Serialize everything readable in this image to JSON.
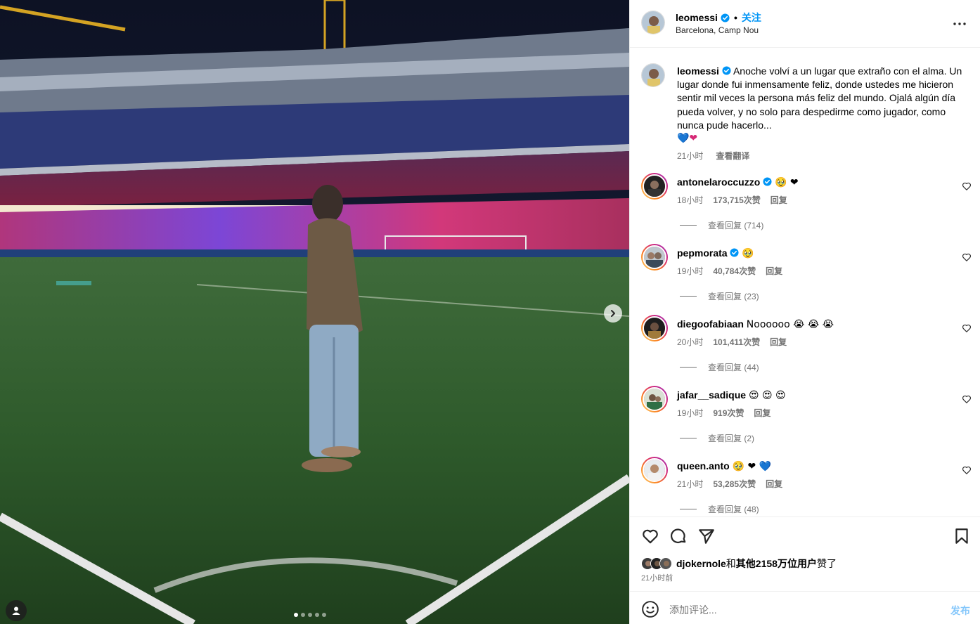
{
  "post": {
    "username": "leomessi",
    "follow_label": "关注",
    "separator": "•",
    "location": "Barcelona, Camp Nou",
    "more_icon": "more-horizontal-icon"
  },
  "caption": {
    "username": "leomessi",
    "text": "Anoche volví a un lugar que extraño con el alma. Un lugar donde fui inmensamente feliz, donde ustedes me hicieron sentir mil veces la persona más feliz del mundo. Ojalá algún día pueda volver, y no solo para despedirme como jugador, como nunca pude hacerlo...",
    "emojis": "💙❤",
    "time": "21小时",
    "translate_label": "查看翻译"
  },
  "comments": [
    {
      "username": "antonelaroccuzzo",
      "verified": true,
      "text": "🥹 ❤",
      "time": "18小时",
      "likes": "173,715次赞",
      "reply_label": "回复",
      "view_replies": "查看回复 (714)"
    },
    {
      "username": "pepmorata",
      "verified": true,
      "text": "🥹",
      "time": "19小时",
      "likes": "40,784次赞",
      "reply_label": "回复",
      "view_replies": "查看回复 (23)"
    },
    {
      "username": "diegoofabiaan",
      "verified": false,
      "text": "Noooooo 😭 😭 😭",
      "time": "20小时",
      "likes": "101,411次赞",
      "reply_label": "回复",
      "view_replies": "查看回复 (44)"
    },
    {
      "username": "jafar__sadique",
      "verified": false,
      "text": "😍 😍 😍",
      "time": "19小时",
      "likes": "919次赞",
      "reply_label": "回复",
      "view_replies": "查看回复 (2)"
    },
    {
      "username": "queen.anto",
      "verified": false,
      "text": "🥹 ❤ 💙",
      "time": "21小时",
      "likes": "53,285次赞",
      "reply_label": "回复",
      "view_replies": "查看回复 (48)"
    }
  ],
  "actions": {
    "liked_by_user": "djokernole",
    "liked_by_connector": "和",
    "liked_by_others": "其他2158万位用户",
    "liked_by_suffix": "赞了",
    "time_ago": "21小时前"
  },
  "composer": {
    "placeholder": "添加评论...",
    "post_label": "发布"
  },
  "colors": {
    "accent": "#0095f6",
    "post_disabled": "#85c7fb",
    "secondary_text": "#737373",
    "verified": "#0095f6"
  },
  "media": {
    "slide_count": 5,
    "active_slide": 1
  }
}
